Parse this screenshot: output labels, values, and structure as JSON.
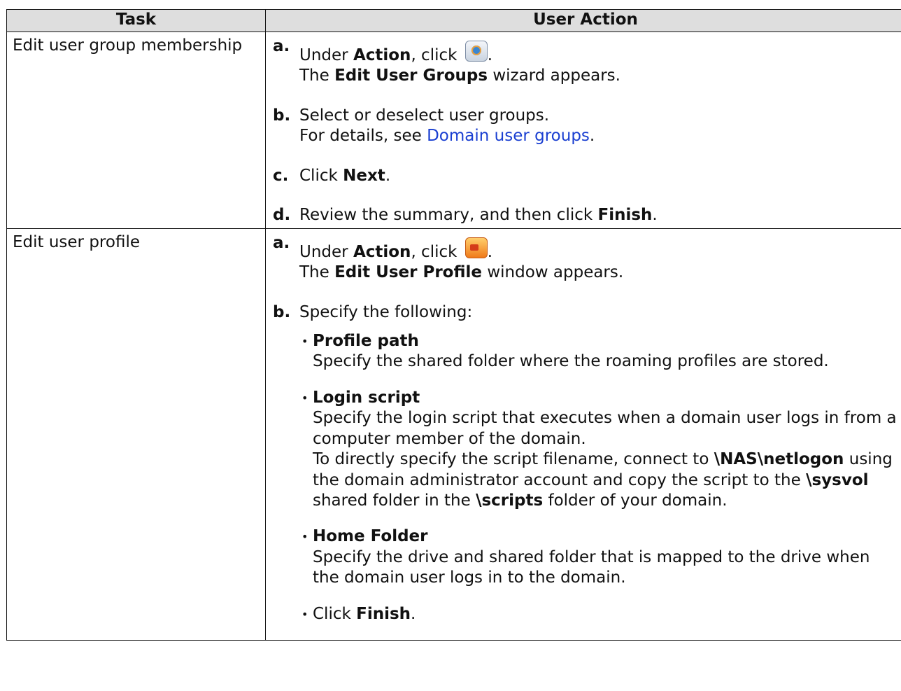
{
  "headers": {
    "task": "Task",
    "action": "User Action"
  },
  "row1": {
    "task": "Edit user group membership",
    "a": {
      "letter": "a.",
      "pre": "Under ",
      "bold": "Action",
      "post": ", click",
      "dot": ".",
      "line2_pre": "The ",
      "line2_bold": "Edit User Groups",
      "line2_post": " wizard appears."
    },
    "b": {
      "letter": "b.",
      "text": "Select or deselect user groups.",
      "line2_pre": "For details, see ",
      "link": "Domain user groups",
      "line2_post": "."
    },
    "c": {
      "letter": "c.",
      "pre": "Click ",
      "bold": "Next",
      "post": "."
    },
    "d": {
      "letter": "d.",
      "pre": "Review the summary, and then click ",
      "bold": "Finish",
      "post": "."
    }
  },
  "row2": {
    "task": "Edit user profile",
    "a": {
      "letter": "a.",
      "pre": "Under ",
      "bold": "Action",
      "post": ", click",
      "dot": ".",
      "line2_pre": "The ",
      "line2_bold": "Edit User Profile",
      "line2_post": " window appears."
    },
    "b": {
      "letter": "b.",
      "text": "Specify the following:"
    },
    "bullets": {
      "profile": {
        "title": "Profile path",
        "desc": "Specify the shared folder where the roaming profiles are stored."
      },
      "login": {
        "title": "Login script",
        "desc1": "Specify the login script that executes when a domain user logs in from a computer member of the domain.",
        "desc2_pre": "To directly specify the script filename, connect to ",
        "desc2_b1": "\\NAS\\netlogon",
        "desc2_mid": " using the domain administrator account and copy the script to the ",
        "desc2_b2": "\\sysvol",
        "desc2_mid2": " shared folder in the ",
        "desc2_b3": "\\scripts",
        "desc2_post": " folder of your domain."
      },
      "home": {
        "title": "Home Folder",
        "desc": "Specify the drive and shared folder that is mapped to the drive when the domain user logs in to the domain."
      },
      "finish": {
        "pre": "Click ",
        "bold": "Finish",
        "post": "."
      }
    }
  },
  "icons": {
    "group": "edit-user-groups-icon",
    "profile": "edit-user-profile-icon"
  }
}
